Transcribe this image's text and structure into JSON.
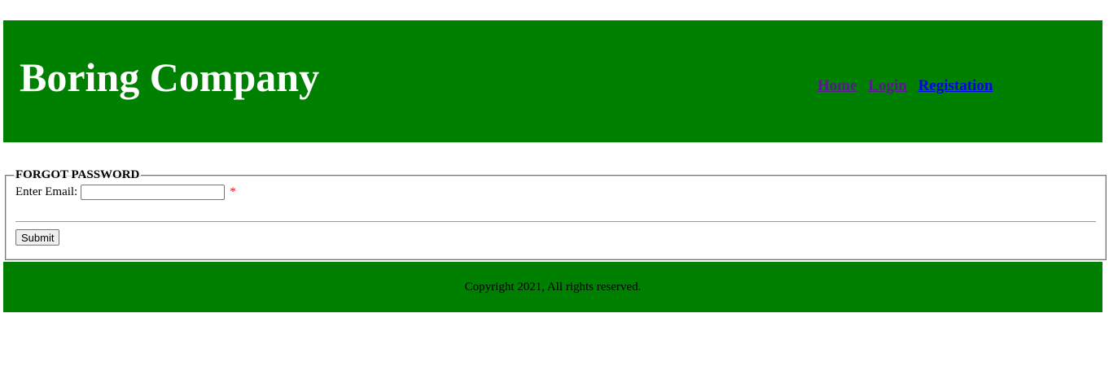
{
  "colors": {
    "header_bg": "#008000",
    "footer_bg": "#008000",
    "title_text": "#ffffff",
    "link_visited": "#551a8b",
    "link_unvisited": "#0000ee",
    "required_marker": "#ff0000"
  },
  "header": {
    "title": "Boring Company",
    "nav": [
      {
        "label": "Home",
        "state": "visited"
      },
      {
        "label": "Login",
        "state": "visited"
      },
      {
        "label": "Registation",
        "state": "unvisited"
      }
    ]
  },
  "form": {
    "legend": "FORGOT PASSWORD",
    "email_label": "Enter Email:",
    "email_value": "",
    "email_placeholder": "",
    "required_marker": "*",
    "submit_label": "Submit"
  },
  "footer": {
    "text": "Copyright 2021, All rights reserved."
  }
}
